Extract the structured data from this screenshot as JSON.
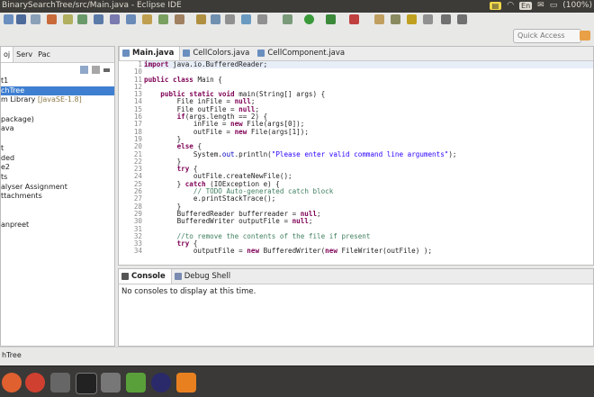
{
  "window": {
    "title": "BinarySearchTree/src/Main.java - Eclipse IDE"
  },
  "system": {
    "battery": "(100%)",
    "language": "En"
  },
  "quick_access": {
    "placeholder": "Quick Access"
  },
  "left_panel": {
    "tabs": [
      "oj",
      "Serv",
      "Pac"
    ],
    "tree": [
      {
        "text": "t1"
      },
      {
        "text": "chTree",
        "selected": true
      },
      {
        "text": "m Library ",
        "extra": "[JavaSE-1.8]"
      },
      {
        "text": ""
      },
      {
        "text": "package)"
      },
      {
        "text": "ava"
      },
      {
        "text": ""
      },
      {
        "text": "t"
      },
      {
        "text": "ded"
      },
      {
        "text": "e2"
      },
      {
        "text": "ts"
      },
      {
        "text": "alyser Assignment"
      },
      {
        "text": "ttachments"
      },
      {
        "text": ""
      },
      {
        "text": ""
      },
      {
        "text": "anpreet"
      }
    ]
  },
  "editor": {
    "tabs": [
      "Main.java",
      "CellColors.java",
      "CellComponent.java"
    ],
    "lines": [
      {
        "n": "1",
        "t": "import java.io.BufferedReader;"
      },
      {
        "n": "10",
        "t": ""
      },
      {
        "n": "11",
        "t": "public class Main {"
      },
      {
        "n": "12",
        "t": ""
      },
      {
        "n": "13",
        "t": "    public static void main(String[] args) {"
      },
      {
        "n": "14",
        "t": "        File inFile = null;"
      },
      {
        "n": "15",
        "t": "        File outFile = null;"
      },
      {
        "n": "16",
        "t": "        if(args.length == 2) {"
      },
      {
        "n": "17",
        "t": "            inFile = new File(args[0]);"
      },
      {
        "n": "18",
        "t": "            outFile = new File(args[1]);"
      },
      {
        "n": "19",
        "t": "        }"
      },
      {
        "n": "20",
        "t": "        else {"
      },
      {
        "n": "21",
        "t": "            System.out.println(\"Please enter valid command line arguments\");"
      },
      {
        "n": "22",
        "t": "        }"
      },
      {
        "n": "23",
        "t": "        try {"
      },
      {
        "n": "24",
        "t": "            outFile.createNewFile();"
      },
      {
        "n": "25",
        "t": "        } catch (IOException e) {"
      },
      {
        "n": "26",
        "t": "            // TODO Auto-generated catch block"
      },
      {
        "n": "27",
        "t": "            e.printStackTrace();"
      },
      {
        "n": "28",
        "t": "        }"
      },
      {
        "n": "29",
        "t": "        BufferedReader bufferreader = null;"
      },
      {
        "n": "30",
        "t": "        BufferedWriter outputFile = null;"
      },
      {
        "n": "31",
        "t": ""
      },
      {
        "n": "32",
        "t": "        //to remove the contents of the file if present"
      },
      {
        "n": "33",
        "t": "        try {"
      },
      {
        "n": "34",
        "t": "            outputFile = new BufferedWriter(new FileWriter(outFile) );"
      }
    ]
  },
  "console": {
    "tabs": [
      "Console",
      "Debug Shell"
    ],
    "message": "No consoles to display at this time."
  },
  "status": {
    "text": "hTree"
  },
  "colors": {
    "titlebar": "#3c3b37",
    "selection": "#3f7fd1",
    "keyword": "#7f0055"
  }
}
